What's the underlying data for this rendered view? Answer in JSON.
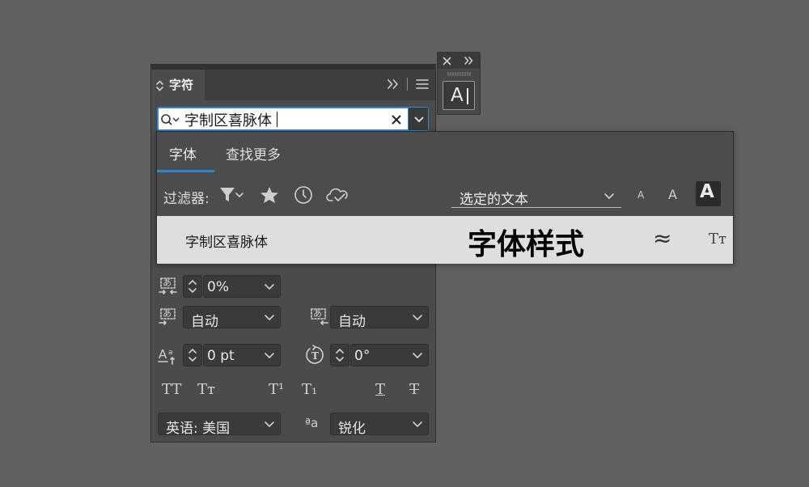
{
  "mini_panel": {
    "icon": "close-icon",
    "collapse_icon": "double-chevron-right-icon",
    "button_glyph": "A"
  },
  "panel": {
    "tab_label": "字符",
    "font_search": {
      "value": "字制区喜脉体"
    },
    "tracking_value": "0%",
    "aki_left_value": "自动",
    "aki_right_value": "自动",
    "baseline_value": "0 pt",
    "rotation_value": "0°",
    "language_value": "英语: 美国",
    "antialias_value": "锐化",
    "antialias_glyph": "ªa"
  },
  "dropdown": {
    "tabs": [
      "字体",
      "查找更多"
    ],
    "filter_label": "过滤器:",
    "sample_select": "选定的文本",
    "size_small": "A",
    "size_medium": "A",
    "size_large": "A",
    "font_row": {
      "name": "字制区喜脉体",
      "sample": "字体样式",
      "similar_glyph": "≈",
      "type_glyph": "Tт"
    }
  },
  "style_buttons": [
    "TT",
    "Tт",
    "T¹",
    "T₁",
    "T",
    "T"
  ],
  "colors": {
    "background": "#606060",
    "panel": "#4b4b4b",
    "accent": "#2f86d6",
    "dropdown_row": "#dedede"
  }
}
